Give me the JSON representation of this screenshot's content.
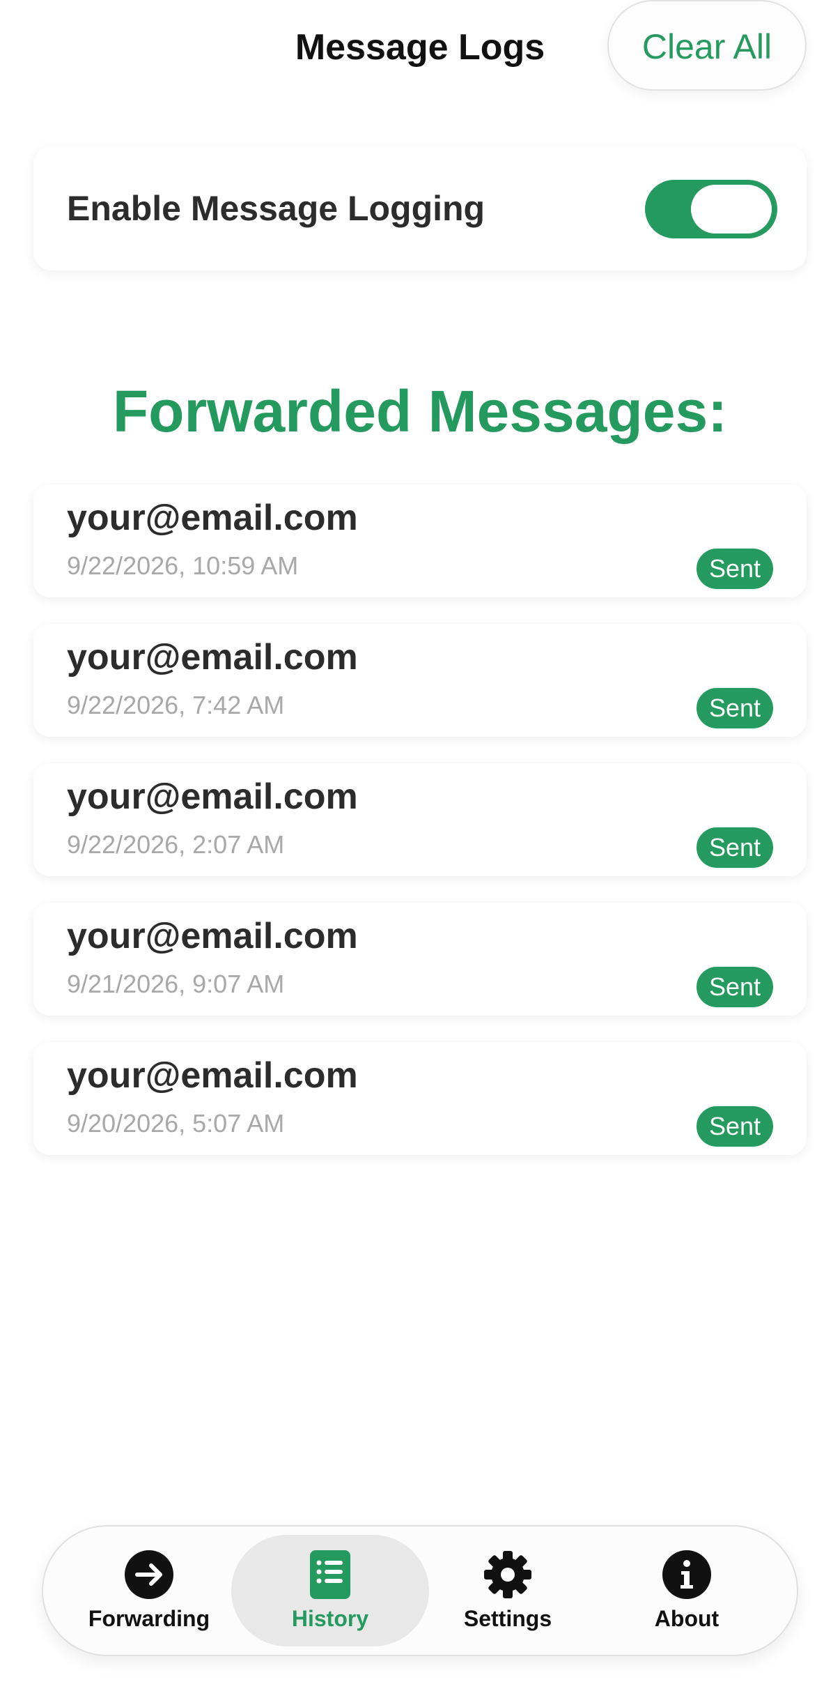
{
  "header": {
    "title": "Message Logs",
    "clear_all_label": "Clear All"
  },
  "logging": {
    "label": "Enable Message Logging",
    "enabled": true
  },
  "section": {
    "heading": "Forwarded Messages:"
  },
  "messages": [
    {
      "email": "your@email.com",
      "timestamp": "9/22/2026, 10:59 AM",
      "status": "Sent"
    },
    {
      "email": "your@email.com",
      "timestamp": "9/22/2026, 7:42 AM",
      "status": "Sent"
    },
    {
      "email": "your@email.com",
      "timestamp": "9/22/2026, 2:07 AM",
      "status": "Sent"
    },
    {
      "email": "your@email.com",
      "timestamp": "9/21/2026, 9:07 AM",
      "status": "Sent"
    },
    {
      "email": "your@email.com",
      "timestamp": "9/20/2026, 5:07 AM",
      "status": "Sent"
    }
  ],
  "nav": {
    "items": [
      {
        "label": "Forwarding",
        "icon": "arrow-right-circle-icon",
        "active": false
      },
      {
        "label": "History",
        "icon": "list-icon",
        "active": true
      },
      {
        "label": "Settings",
        "icon": "gear-icon",
        "active": false
      },
      {
        "label": "About",
        "icon": "info-icon",
        "active": false
      }
    ]
  },
  "colors": {
    "accent": "#259A5E",
    "text": "#2c2c2c",
    "muted": "#a8a8a8"
  }
}
